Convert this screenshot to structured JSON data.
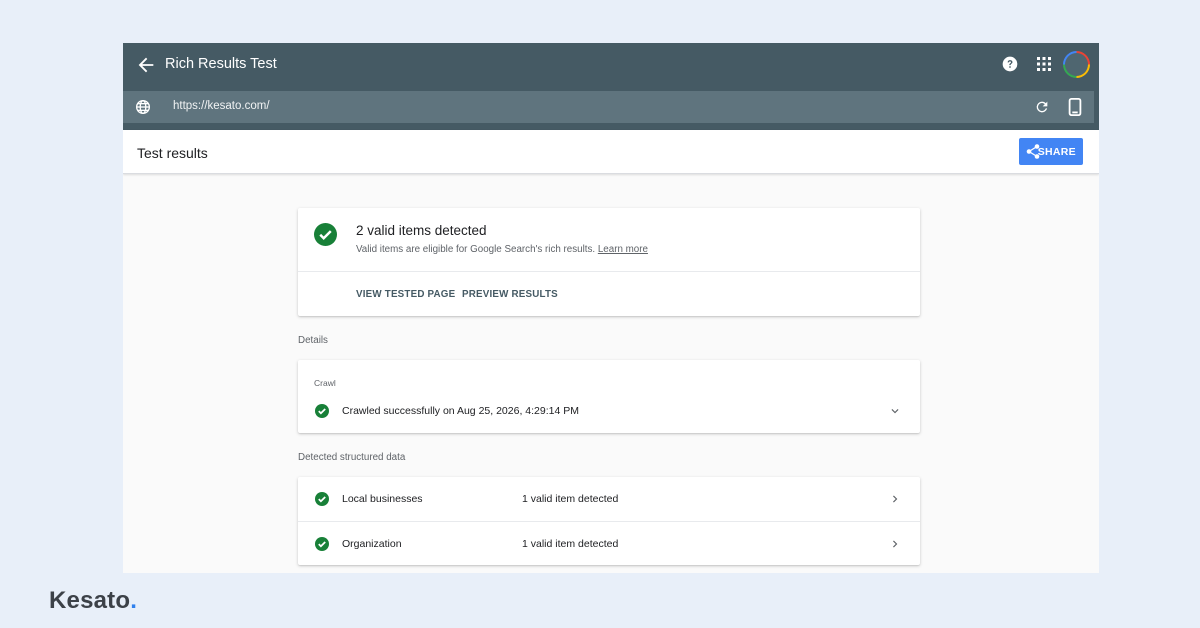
{
  "app": {
    "title": "Rich Results Test",
    "url": "https://kesato.com/"
  },
  "header": {
    "title": "Test results",
    "share_label": "SHARE"
  },
  "summary": {
    "title": "2 valid items detected",
    "description": "Valid items are eligible for Google Search's rich results.",
    "learn_more": "Learn more",
    "actions": [
      "VIEW TESTED PAGE",
      "PREVIEW RESULTS"
    ]
  },
  "details": {
    "label": "Details",
    "crawl_heading": "Crawl",
    "crawl_status": "Crawled successfully on Aug 25, 2026, 4:29:14 PM"
  },
  "structured_data": {
    "label": "Detected structured data",
    "items": [
      {
        "name": "Local businesses",
        "status": "1 valid item detected"
      },
      {
        "name": "Organization",
        "status": "1 valid item detected"
      }
    ]
  },
  "brand": {
    "name": "Kesato",
    "dot": "."
  },
  "colors": {
    "appbar": "#455a64",
    "urlbar": "#5f747e",
    "accent": "#4285f4",
    "success": "#188038",
    "page_bg": "#e8eff9"
  },
  "icons": {
    "back": "arrow-left-icon",
    "help": "help-icon",
    "apps": "apps-grid-icon",
    "globe": "globe-icon",
    "reload": "reload-icon",
    "device": "smartphone-icon",
    "share": "share-icon",
    "check": "check-circle-icon",
    "expand": "chevron-down-icon",
    "open": "chevron-right-icon"
  }
}
